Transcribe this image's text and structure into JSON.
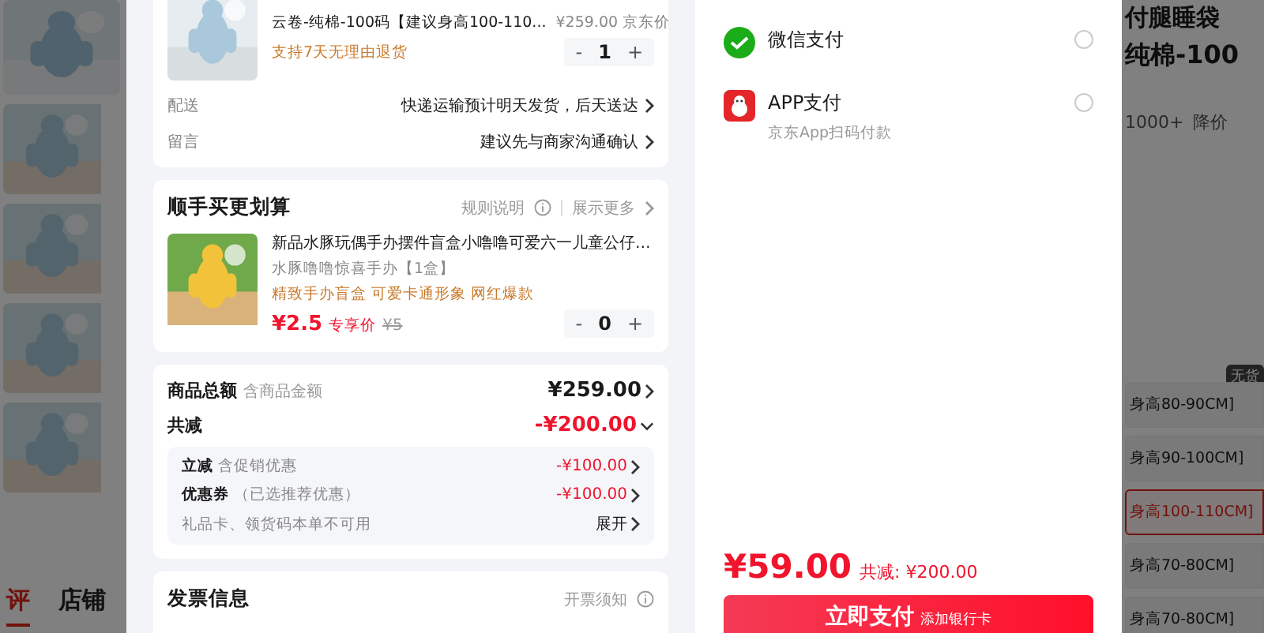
{
  "product": {
    "spec": "云卷-纯棉-100码【建议身高100-110...",
    "price": "¥259.00",
    "price_label": "京东价",
    "service": "支持7天无理由退货",
    "stepper": {
      "minus": "-",
      "qty": "1",
      "plus": "+"
    }
  },
  "order_rows": [
    {
      "label": "配送",
      "value": "快递运输预计明天发货，后天送达"
    },
    {
      "label": "留言",
      "value": "建议先与商家沟通确认"
    }
  ],
  "addon": {
    "title": "顺手买更划算",
    "rules": "规则说明",
    "more": "展示更多",
    "item": {
      "title": "新品水豚玩偶手办摆件盲盒小噜噜可爱六一儿童公仔…",
      "spec": "水豚噜噜惊喜手办【1盒】",
      "tags": "精致手办盲盒 可爱卡通形象 网红爆款",
      "price": "¥2.5",
      "price_label": "专享价",
      "old_price": "¥5",
      "stepper": {
        "minus": "-",
        "qty": "0",
        "plus": "+"
      }
    }
  },
  "summary": {
    "total_label": "商品总额",
    "total_note": "含商品金额",
    "total": "¥259.00",
    "discount_label": "共减",
    "discount": "-¥200.00",
    "expanded": true,
    "details": [
      {
        "label": "立减",
        "note": "含促销优惠",
        "value": "-¥100.00"
      },
      {
        "label": "优惠券",
        "note": "（已选推荐优惠）",
        "value": "-¥100.00"
      }
    ],
    "gift_note": "礼品卡、领货码本单不可用",
    "gift_action": "展开"
  },
  "invoice": {
    "title": "发票信息",
    "notice": "开票须知"
  },
  "payment_methods": [
    {
      "kind": "wechat",
      "name": "微信支付",
      "selected": false
    },
    {
      "kind": "app",
      "name": "APP支付",
      "note": "京东App扫码付款",
      "selected": false
    }
  ],
  "pay": {
    "amount": "¥59.00",
    "saved_label": "共减:",
    "saved": "¥200.00",
    "button": "立即支付",
    "button_note": "添加银行卡"
  },
  "background": {
    "left_tabs": [
      {
        "label": "评",
        "selected": true
      },
      {
        "label": "店铺",
        "selected": false
      }
    ],
    "right_title": "付腿睡袋",
    "right_subtitle": "纯棉-100",
    "sales": "1000+",
    "price_drop": "降价",
    "stock_badge": "无货",
    "sizes": [
      {
        "label": "身高80-90CM]",
        "selected": false
      },
      {
        "label": "身高90-100CM]",
        "selected": false
      },
      {
        "label": "身高100-110CM]",
        "selected": true
      },
      {
        "label": "身高70-80CM]",
        "selected": false
      },
      {
        "label": "身高70-80CM]",
        "selected": false
      }
    ]
  }
}
